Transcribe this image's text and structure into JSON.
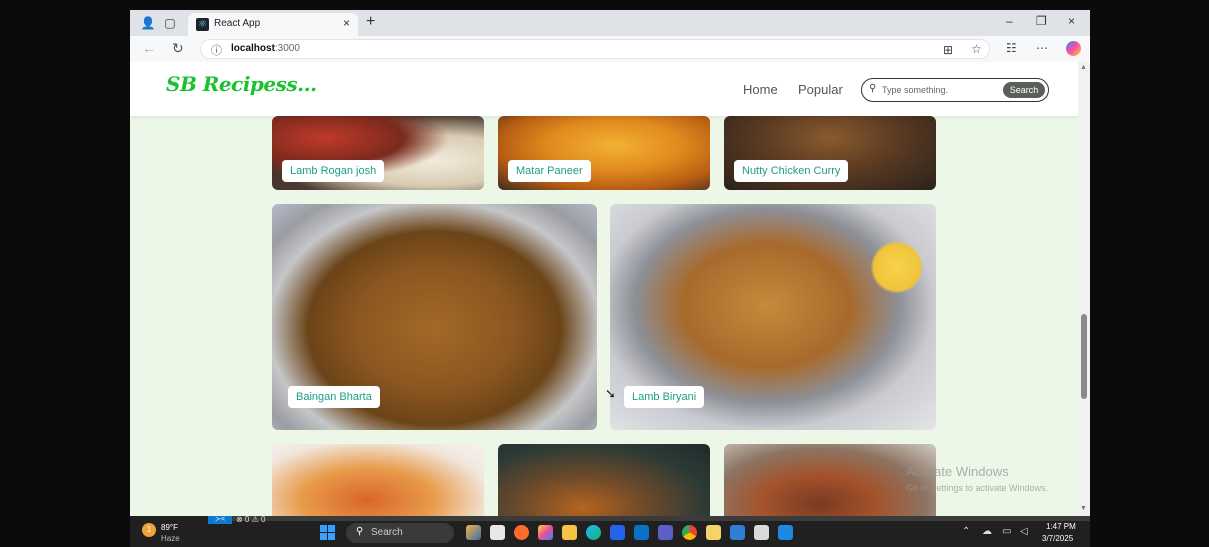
{
  "browser": {
    "tab_title": "React App",
    "tab_close": "×",
    "new_tab": "+",
    "url_host": "localhost",
    "url_port": ":3000",
    "window_controls": [
      "–",
      "❐",
      "×"
    ]
  },
  "site": {
    "logo": "SB Recipess...",
    "nav": [
      "Home",
      "Popular"
    ],
    "search": {
      "placeholder": "Type something.",
      "button": "Search"
    }
  },
  "recipes": [
    {
      "name": "Lamb Rogan josh"
    },
    {
      "name": "Matar Paneer"
    },
    {
      "name": "Nutty Chicken Curry"
    },
    {
      "name": "Baingan Bharta"
    },
    {
      "name": "Lamb Biryani"
    }
  ],
  "watermark": {
    "title": "Activate Windows",
    "subtitle": "Go to Settings to activate Windows."
  },
  "taskbar": {
    "weather_temp": "89°F",
    "weather_desc": "Haze",
    "weather_badge": "1",
    "search_label": "Search",
    "vscode_status": "⊗ 0 ⚠ 0",
    "time": "1:47 PM",
    "date": "3/7/2025"
  },
  "icons": {
    "profile": "profile-icon",
    "tab_actions": "tab-actions-icon",
    "back": "back-arrow-icon",
    "refresh": "refresh-icon",
    "info": "info-icon",
    "split": "split-screen-icon",
    "favorite": "star-icon",
    "collections": "collections-icon",
    "more": "more-icon",
    "copilot": "copilot-icon",
    "search": "search-icon"
  }
}
